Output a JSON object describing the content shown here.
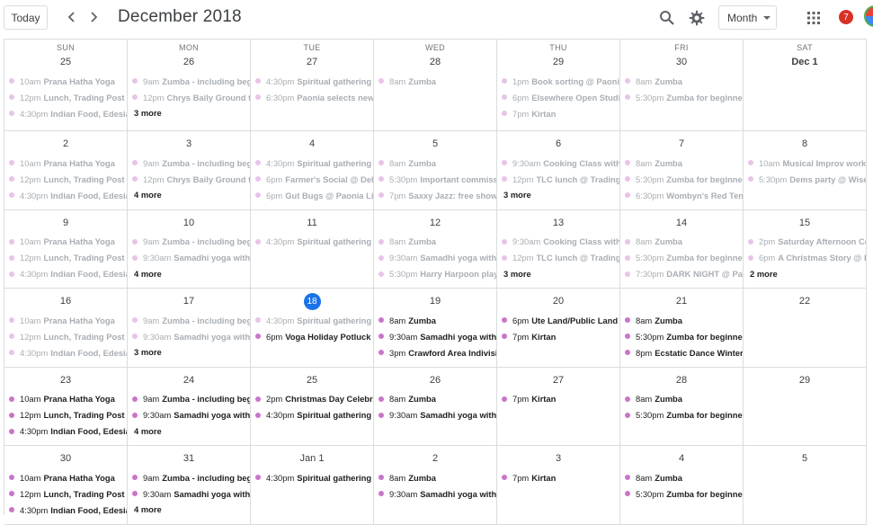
{
  "header": {
    "today_label": "Today",
    "title": "December 2018",
    "view_label": "Month",
    "notification_count": "7",
    "icons": [
      "chevron-left-icon",
      "chevron-right-icon",
      "search-icon",
      "gear-icon",
      "apps-grid-icon"
    ]
  },
  "colors": {
    "event_dot": "#c975c9",
    "event_dot_past": "#e8c4e8",
    "today": "#1a73e8",
    "badge": "#d93025"
  },
  "weeks": [
    [
      {
        "dow": "SUN",
        "day": "25",
        "events": [
          {
            "time": "10am",
            "title": "Prana Hatha Yoga"
          },
          {
            "time": "12pm",
            "title": "Lunch, Trading Post"
          },
          {
            "time": "4:30pm",
            "title": "Indian Food, Edesia"
          }
        ]
      },
      {
        "dow": "MON",
        "day": "26",
        "events": [
          {
            "time": "9am",
            "title": "Zumba - including begi"
          },
          {
            "time": "12pm",
            "title": "Chrys Baily Ground to"
          }
        ],
        "more": "3 more"
      },
      {
        "dow": "TUE",
        "day": "27",
        "events": [
          {
            "time": "4:30pm",
            "title": "Spiritual gathering"
          },
          {
            "time": "6:30pm",
            "title": "Paonia selects new"
          }
        ]
      },
      {
        "dow": "WED",
        "day": "28",
        "events": [
          {
            "time": "8am",
            "title": "Zumba"
          }
        ]
      },
      {
        "dow": "THU",
        "day": "29",
        "events": [
          {
            "time": "1pm",
            "title": "Book sorting @ Paonia"
          },
          {
            "time": "6pm",
            "title": "Elsewhere Open Studio"
          },
          {
            "time": "7pm",
            "title": "Kirtan"
          }
        ]
      },
      {
        "dow": "FRI",
        "day": "30",
        "events": [
          {
            "time": "8am",
            "title": "Zumba"
          },
          {
            "time": "5:30pm",
            "title": "Zumba for beginner"
          }
        ]
      },
      {
        "dow": "SAT",
        "day": "Dec 1",
        "bold": true,
        "events": []
      }
    ],
    [
      {
        "day": "2",
        "events": [
          {
            "time": "10am",
            "title": "Prana Hatha Yoga"
          },
          {
            "time": "12pm",
            "title": "Lunch, Trading Post"
          },
          {
            "time": "4:30pm",
            "title": "Indian Food, Edesia"
          }
        ]
      },
      {
        "day": "3",
        "events": [
          {
            "time": "9am",
            "title": "Zumba - including begi"
          },
          {
            "time": "12pm",
            "title": "Chrys Baily Ground to"
          }
        ],
        "more": "4 more"
      },
      {
        "day": "4",
        "events": [
          {
            "time": "4:30pm",
            "title": "Spiritual gathering"
          },
          {
            "time": "6pm",
            "title": "Farmer's Social @ Delic"
          },
          {
            "time": "6pm",
            "title": "Gut Bugs @ Paonia Lib"
          }
        ]
      },
      {
        "day": "5",
        "events": [
          {
            "time": "8am",
            "title": "Zumba"
          },
          {
            "time": "5:30pm",
            "title": "Important commissio"
          },
          {
            "time": "7pm",
            "title": "Saxxy Jazz: free show"
          }
        ]
      },
      {
        "day": "6",
        "events": [
          {
            "time": "9:30am",
            "title": "Cooking Class with"
          },
          {
            "time": "12pm",
            "title": "TLC lunch @ Trading P"
          }
        ],
        "more": "3 more"
      },
      {
        "day": "7",
        "events": [
          {
            "time": "8am",
            "title": "Zumba"
          },
          {
            "time": "5:30pm",
            "title": "Zumba for beginner"
          },
          {
            "time": "6:30pm",
            "title": "Wombyn's Red Tent"
          }
        ]
      },
      {
        "day": "8",
        "events": [
          {
            "time": "10am",
            "title": "Musical Improv works"
          },
          {
            "time": "5:30pm",
            "title": "Dems party @ Wisel"
          }
        ]
      }
    ],
    [
      {
        "day": "9",
        "events": [
          {
            "time": "10am",
            "title": "Prana Hatha Yoga"
          },
          {
            "time": "12pm",
            "title": "Lunch, Trading Post"
          },
          {
            "time": "4:30pm",
            "title": "Indian Food, Edesia"
          }
        ]
      },
      {
        "day": "10",
        "events": [
          {
            "time": "9am",
            "title": "Zumba - including begi"
          },
          {
            "time": "9:30am",
            "title": "Samadhi yoga with I"
          }
        ],
        "more": "4 more"
      },
      {
        "day": "11",
        "events": [
          {
            "time": "4:30pm",
            "title": "Spiritual gathering"
          }
        ]
      },
      {
        "day": "12",
        "events": [
          {
            "time": "8am",
            "title": "Zumba"
          },
          {
            "time": "9:30am",
            "title": "Samadhi yoga with I"
          },
          {
            "time": "5:30pm",
            "title": "Harry Harpoon plays"
          }
        ]
      },
      {
        "day": "13",
        "events": [
          {
            "time": "9:30am",
            "title": "Cooking Class with"
          },
          {
            "time": "12pm",
            "title": "TLC lunch @ Trading P"
          }
        ],
        "more": "3 more"
      },
      {
        "day": "14",
        "events": [
          {
            "time": "8am",
            "title": "Zumba"
          },
          {
            "time": "5:30pm",
            "title": "Zumba for beginner"
          },
          {
            "time": "7:30pm",
            "title": "DARK NIGHT @ Par"
          }
        ]
      },
      {
        "day": "15",
        "events": [
          {
            "time": "2pm",
            "title": "Saturday Afternoon Co"
          },
          {
            "time": "6pm",
            "title": "A Christmas Story @ B"
          }
        ],
        "more": "2 more"
      }
    ],
    [
      {
        "day": "16",
        "events": [
          {
            "time": "10am",
            "title": "Prana Hatha Yoga"
          },
          {
            "time": "12pm",
            "title": "Lunch, Trading Post"
          },
          {
            "time": "4:30pm",
            "title": "Indian Food, Edesia"
          }
        ]
      },
      {
        "day": "17",
        "events": [
          {
            "time": "9am",
            "title": "Zumba - including begi"
          },
          {
            "time": "9:30am",
            "title": "Samadhi yoga with I"
          }
        ],
        "more": "3 more"
      },
      {
        "day": "18",
        "today": true,
        "events": [
          {
            "time": "4:30pm",
            "title": "Spiritual gathering"
          },
          {
            "time": "6pm",
            "title": "Voga Holiday Potluck F",
            "current": true
          }
        ]
      },
      {
        "day": "19",
        "events": [
          {
            "time": "8am",
            "title": "Zumba",
            "current": true
          },
          {
            "time": "9:30am",
            "title": "Samadhi yoga with I",
            "current": true
          },
          {
            "time": "3pm",
            "title": "Crawford Area Indivisit",
            "current": true
          }
        ]
      },
      {
        "day": "20",
        "events": [
          {
            "time": "6pm",
            "title": "Ute Land/Public Land t",
            "current": true
          },
          {
            "time": "7pm",
            "title": "Kirtan",
            "current": true
          }
        ]
      },
      {
        "day": "21",
        "events": [
          {
            "time": "8am",
            "title": "Zumba",
            "current": true
          },
          {
            "time": "5:30pm",
            "title": "Zumba for beginner",
            "current": true
          },
          {
            "time": "8pm",
            "title": "Ecstatic Dance Winter S",
            "current": true
          }
        ]
      },
      {
        "day": "22",
        "events": []
      }
    ],
    [
      {
        "day": "23",
        "events": [
          {
            "time": "10am",
            "title": "Prana Hatha Yoga",
            "current": true
          },
          {
            "time": "12pm",
            "title": "Lunch, Trading Post",
            "current": true
          },
          {
            "time": "4:30pm",
            "title": "Indian Food, Edesia",
            "current": true
          }
        ]
      },
      {
        "day": "24",
        "events": [
          {
            "time": "9am",
            "title": "Zumba - including begi",
            "current": true
          },
          {
            "time": "9:30am",
            "title": "Samadhi yoga with I",
            "current": true
          }
        ],
        "more": "4 more"
      },
      {
        "day": "25",
        "events": [
          {
            "time": "2pm",
            "title": "Christmas Day Celebra",
            "current": true
          },
          {
            "time": "4:30pm",
            "title": "Spiritual gathering",
            "current": true
          }
        ]
      },
      {
        "day": "26",
        "events": [
          {
            "time": "8am",
            "title": "Zumba",
            "current": true
          },
          {
            "time": "9:30am",
            "title": "Samadhi yoga with I",
            "current": true
          }
        ]
      },
      {
        "day": "27",
        "events": [
          {
            "time": "7pm",
            "title": "Kirtan",
            "current": true
          }
        ]
      },
      {
        "day": "28",
        "events": [
          {
            "time": "8am",
            "title": "Zumba",
            "current": true
          },
          {
            "time": "5:30pm",
            "title": "Zumba for beginner",
            "current": true
          }
        ]
      },
      {
        "day": "29",
        "events": []
      }
    ],
    [
      {
        "day": "30",
        "events": [
          {
            "time": "10am",
            "title": "Prana Hatha Yoga",
            "current": true
          },
          {
            "time": "12pm",
            "title": "Lunch, Trading Post",
            "current": true
          },
          {
            "time": "4:30pm",
            "title": "Indian Food, Edesia",
            "current": true
          }
        ]
      },
      {
        "day": "31",
        "events": [
          {
            "time": "9am",
            "title": "Zumba - including begi",
            "current": true
          },
          {
            "time": "9:30am",
            "title": "Samadhi yoga with I",
            "current": true
          }
        ],
        "more": "4 more"
      },
      {
        "day": "Jan 1",
        "events": [
          {
            "time": "4:30pm",
            "title": "Spiritual gathering",
            "current": true
          }
        ]
      },
      {
        "day": "2",
        "events": [
          {
            "time": "8am",
            "title": "Zumba",
            "current": true
          },
          {
            "time": "9:30am",
            "title": "Samadhi yoga with I",
            "current": true
          }
        ]
      },
      {
        "day": "3",
        "events": [
          {
            "time": "7pm",
            "title": "Kirtan",
            "current": true
          }
        ]
      },
      {
        "day": "4",
        "events": [
          {
            "time": "8am",
            "title": "Zumba",
            "current": true
          },
          {
            "time": "5:30pm",
            "title": "Zumba for beginner",
            "current": true
          }
        ]
      },
      {
        "day": "5",
        "events": []
      }
    ]
  ]
}
